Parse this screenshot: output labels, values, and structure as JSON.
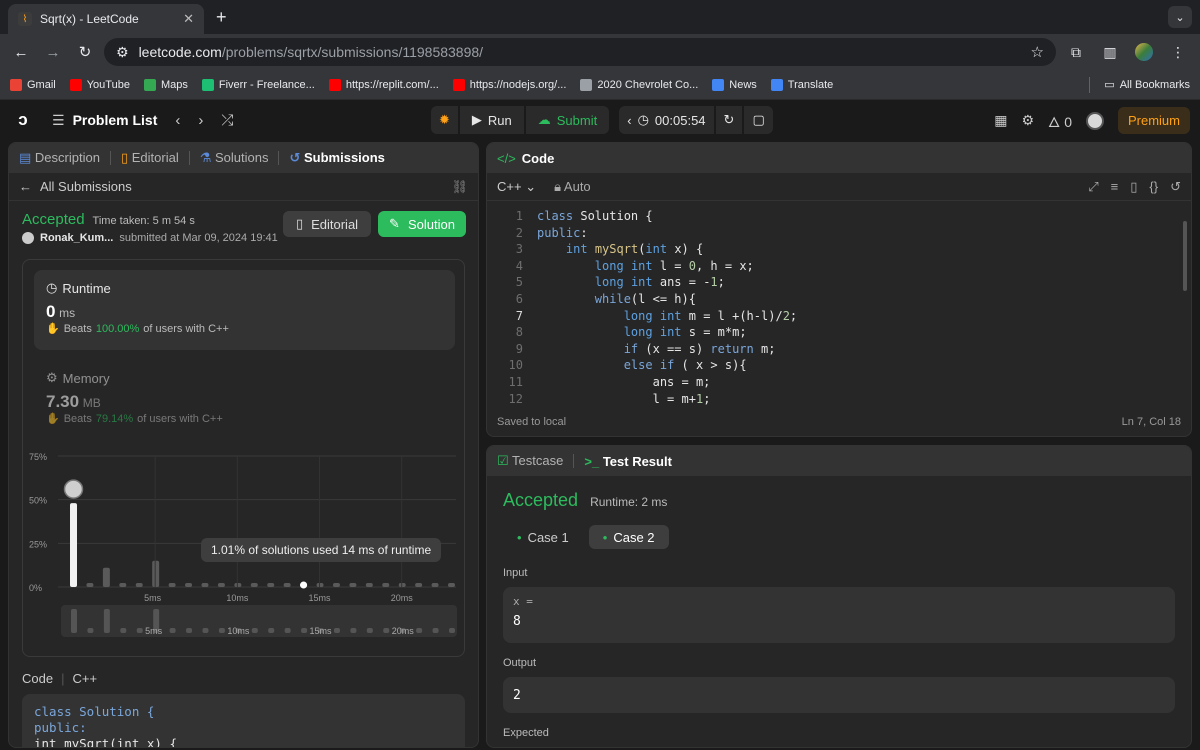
{
  "browser": {
    "tab_title": "Sqrt(x) - LeetCode",
    "url_host": "leetcode.com",
    "url_path": "/problems/sqrtx/submissions/1198583898/",
    "bookmarks": [
      {
        "label": "Gmail",
        "color": "#ea4335"
      },
      {
        "label": "YouTube",
        "color": "#ff0000"
      },
      {
        "label": "Maps",
        "color": "#34a853"
      },
      {
        "label": "Fiverr - Freelance...",
        "color": "#1dbf73"
      },
      {
        "label": "https://replit.com/...",
        "color": "#ff0000"
      },
      {
        "label": "https://nodejs.org/...",
        "color": "#ff0000"
      },
      {
        "label": "2020 Chevrolet Co...",
        "color": "#9aa0a6"
      },
      {
        "label": "News",
        "color": "#4285f4"
      },
      {
        "label": "Translate",
        "color": "#4285f4"
      }
    ],
    "all_bookmarks": "All Bookmarks"
  },
  "nav": {
    "problem_list": "Problem List",
    "run": "Run",
    "submit": "Submit",
    "timer": "00:05:54",
    "streak": "0",
    "premium": "Premium"
  },
  "left": {
    "tabs": [
      "Description",
      "Editorial",
      "Solutions",
      "Submissions"
    ],
    "back": "All Submissions",
    "status": "Accepted",
    "time_taken": "Time taken: 5 m 54 s",
    "user": "Ronak_Kum...",
    "submitted": "submitted at Mar 09, 2024 19:41",
    "editorial_btn": "Editorial",
    "solution_btn": "Solution",
    "runtime_label": "Runtime",
    "runtime_value": "0",
    "runtime_unit": "ms",
    "runtime_beats": "Beats",
    "runtime_pct": "100.00%",
    "runtime_of": "of users with C++",
    "memory_label": "Memory",
    "memory_value": "7.30",
    "memory_unit": "MB",
    "memory_beats": "Beats",
    "memory_pct": "79.14%",
    "memory_of": "of users with C++",
    "tooltip": "1.01% of solutions used 14 ms of runtime",
    "code_label": "Code",
    "code_lang": "C++",
    "code_preview": [
      "class Solution {",
      "public:",
      "    int mySqrt(int x) {"
    ]
  },
  "chart_data": {
    "type": "bar",
    "y_ticks": [
      "75%",
      "50%",
      "25%",
      "0%"
    ],
    "x_ticks": [
      "5ms",
      "10ms",
      "15ms",
      "20ms"
    ],
    "ylim": [
      0,
      75
    ],
    "values": [
      48,
      1,
      11,
      1,
      1,
      15,
      1,
      1,
      1,
      1,
      1,
      1,
      1,
      1,
      1,
      1,
      1,
      1,
      1,
      1,
      1,
      1,
      1,
      1
    ],
    "mini_x_ticks": [
      "5ms",
      "10ms",
      "15ms",
      "20ms"
    ]
  },
  "editor": {
    "title": "Code",
    "lang": "C++",
    "mode": "Auto",
    "saved": "Saved to local",
    "cursor": "Ln 7, Col 18",
    "lines": [
      "class Solution {",
      "public:",
      "    int mySqrt(int x) {",
      "        long int l = 0, h = x;",
      "        long int ans = -1;",
      "        while(l <= h){",
      "            long int m = l +(h-l)/2;",
      "            long int s = m*m;",
      "            if (x == s) return m;",
      "            else if ( x > s){",
      "                ans = m;",
      "                l = m+1;"
    ]
  },
  "result": {
    "tab_testcase": "Testcase",
    "tab_result": "Test Result",
    "status": "Accepted",
    "runtime": "Runtime: 2 ms",
    "case1": "Case 1",
    "case2": "Case 2",
    "input_label": "Input",
    "input_var": "x =",
    "input_val": "8",
    "output_label": "Output",
    "output_val": "2",
    "expected_label": "Expected"
  }
}
